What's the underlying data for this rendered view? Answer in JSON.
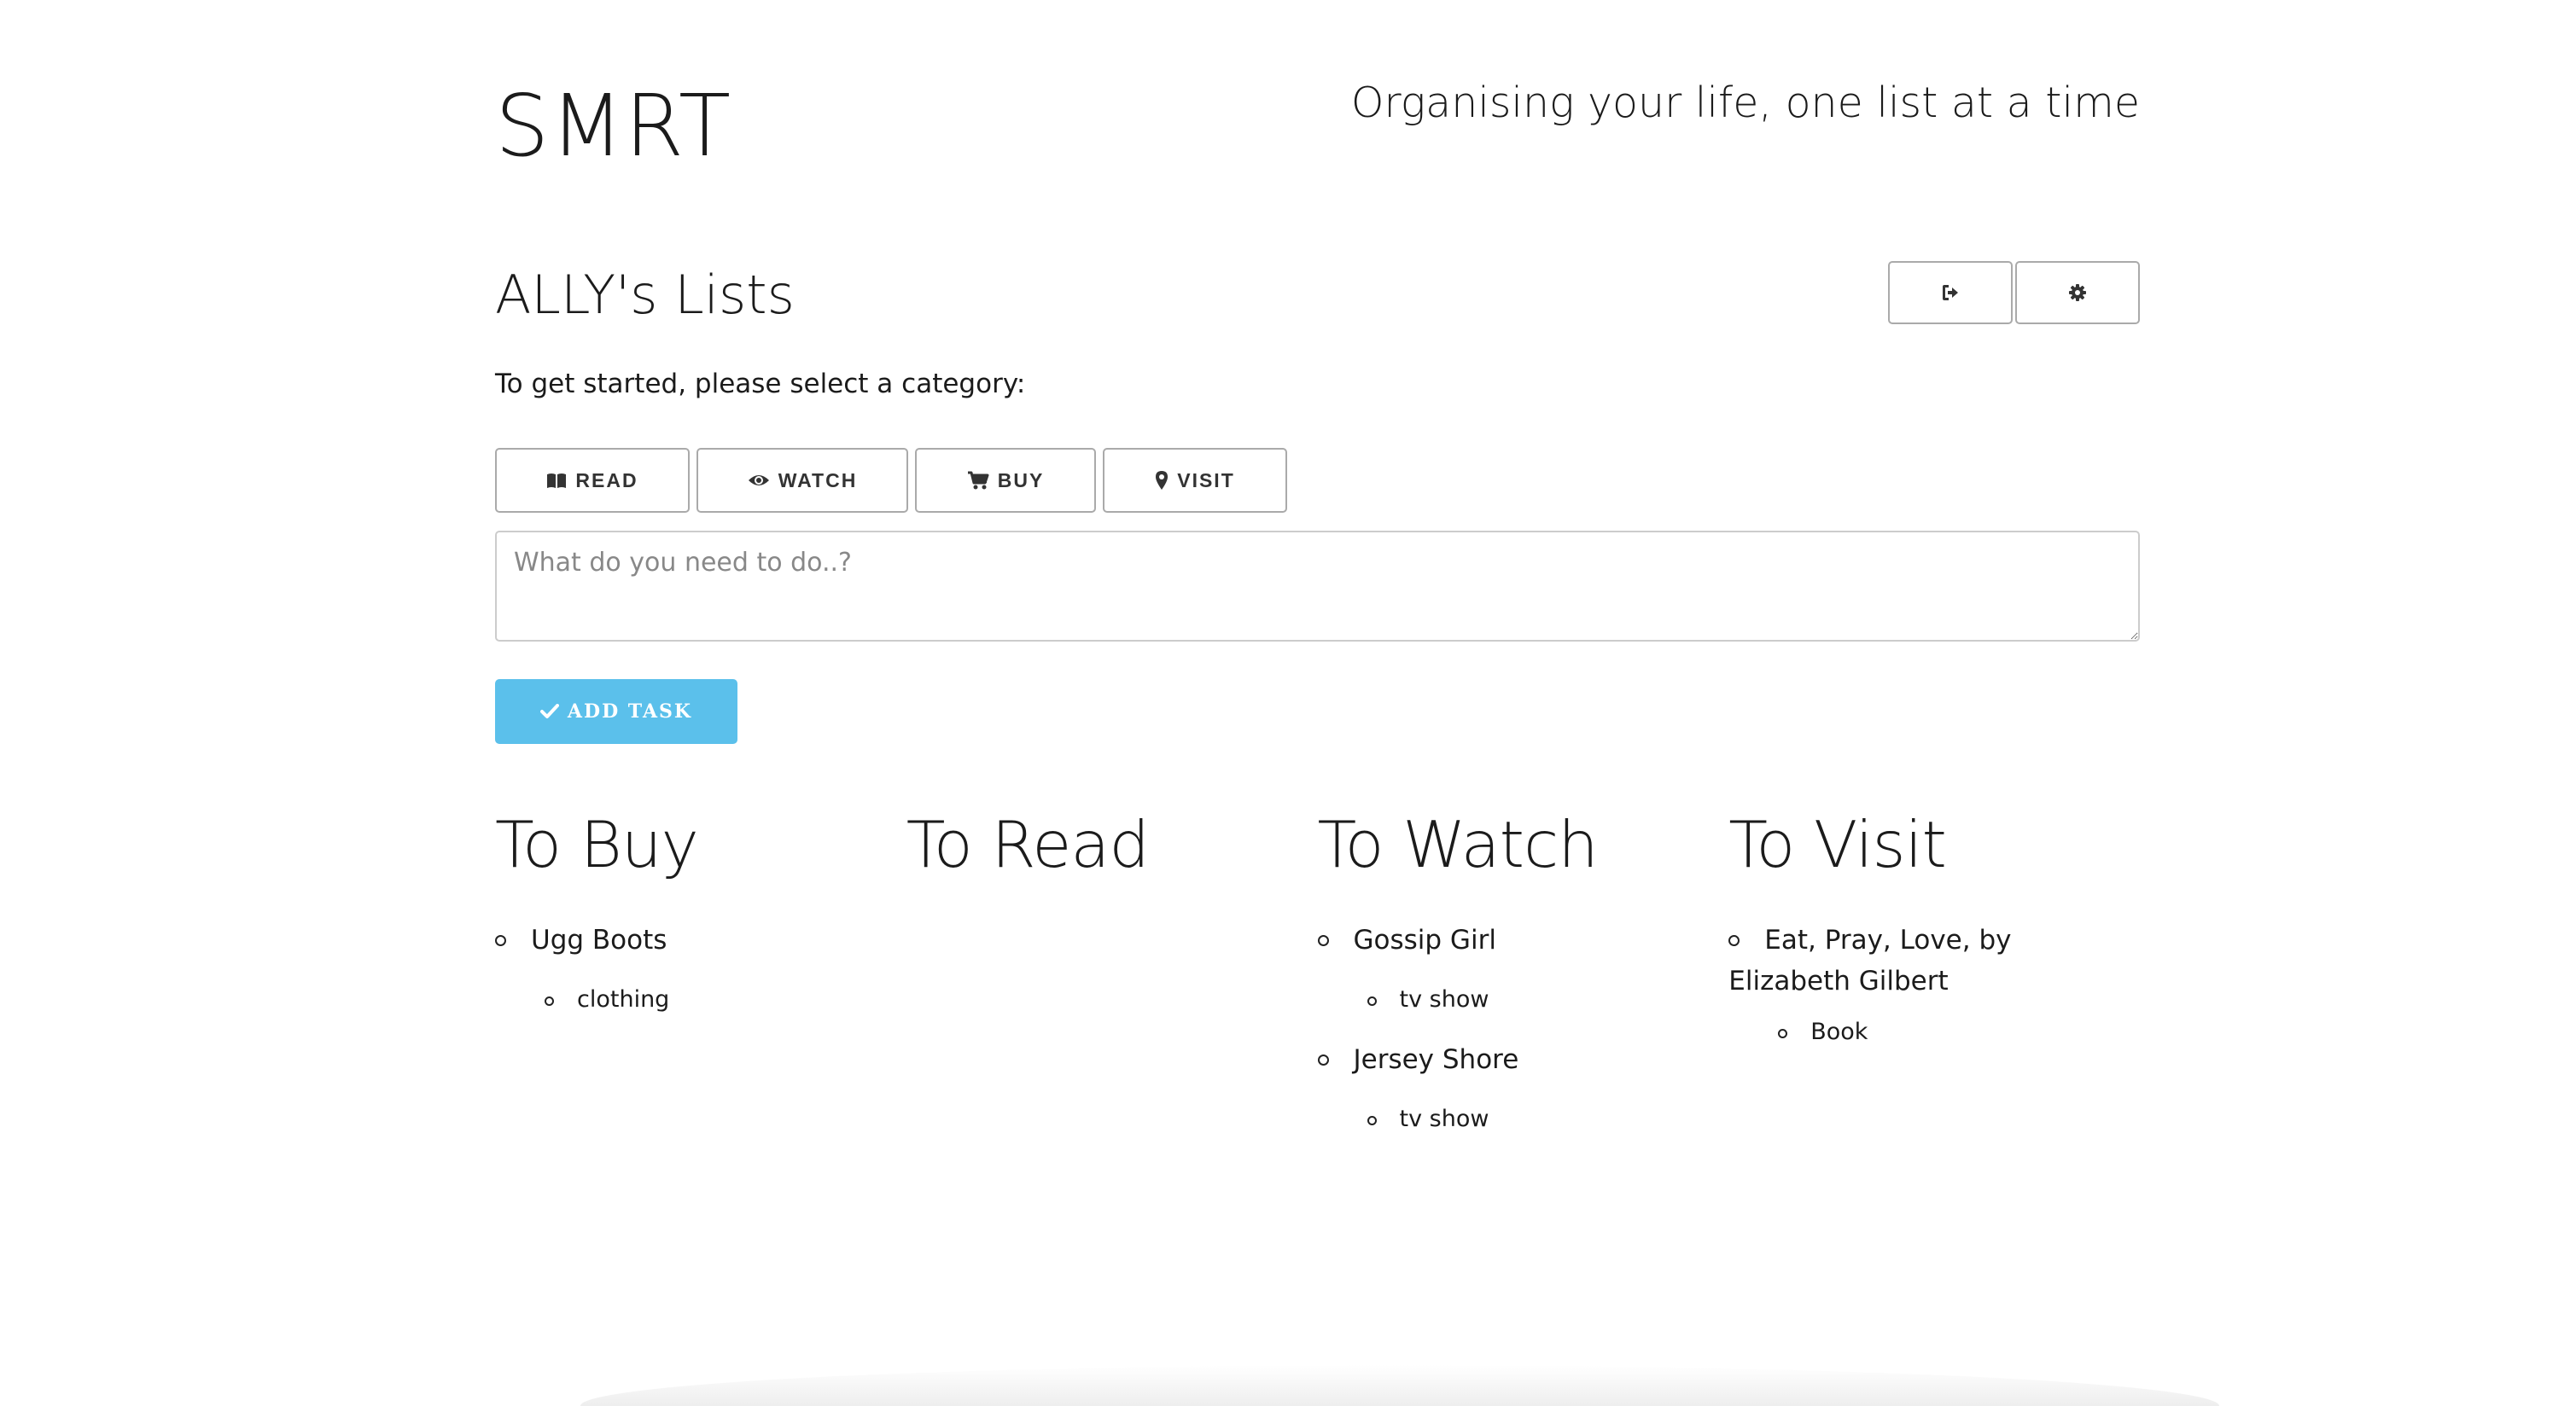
{
  "header": {
    "brand": "SMRT",
    "tagline": "Organising your life, one list at a time"
  },
  "user": {
    "lists_title": "ALLY's Lists"
  },
  "top_actions": {
    "logout_icon": "sign-out-icon",
    "settings_icon": "gear-icon"
  },
  "prompt": "To get started, please select a category:",
  "categories": [
    {
      "label": "READ",
      "icon": "book-icon"
    },
    {
      "label": "WATCH",
      "icon": "eye-icon"
    },
    {
      "label": "BUY",
      "icon": "cart-icon"
    },
    {
      "label": "VISIT",
      "icon": "map-marker-icon"
    }
  ],
  "task_input": {
    "placeholder": "What do you need to do..?"
  },
  "add_button": {
    "label": "ADD TASK",
    "icon": "check-icon",
    "color": "#5bc0eb"
  },
  "columns": {
    "buy": {
      "title": "To Buy",
      "items": [
        {
          "name": "Ugg Boots",
          "tag": "clothing"
        }
      ]
    },
    "read": {
      "title": "To Read",
      "items": []
    },
    "watch": {
      "title": "To Watch",
      "items": [
        {
          "name": "Gossip Girl",
          "tag": "tv show"
        },
        {
          "name": "Jersey Shore",
          "tag": "tv show"
        }
      ]
    },
    "visit": {
      "title": "To Visit",
      "items": [
        {
          "name": "Eat, Pray, Love, by Elizabeth Gilbert",
          "tag": "Book"
        }
      ]
    }
  }
}
